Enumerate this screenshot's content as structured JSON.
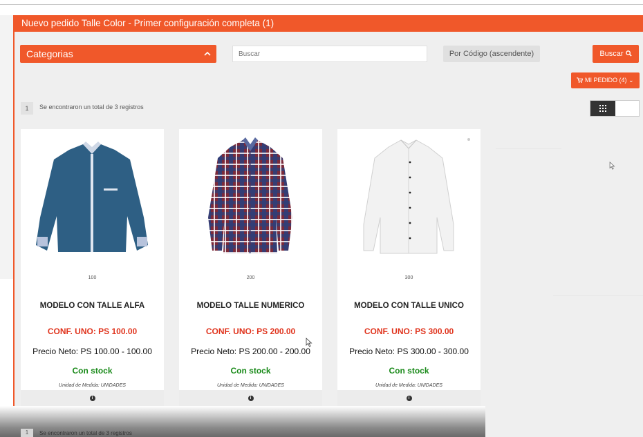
{
  "window": {
    "title": "Nuevo pedido Talle Color - Primer configuración completa (1)"
  },
  "toolbar": {
    "categories_label": "Categorias",
    "search_placeholder": "Buscar",
    "sort_label": "Por Código (ascendente)",
    "search_button": "Buscar",
    "order_button": "MI PEDIDO",
    "order_count": "(4)"
  },
  "results": {
    "page": "1",
    "summary": "Se encontraron un total de 3 registros"
  },
  "products": [
    {
      "code": "100",
      "name": "MODELO CON TALLE ALFA",
      "conf": "CONF. UNO: PS 100.00",
      "neto": "Precio Neto: PS 100.00 - 100.00",
      "stock": "Con stock",
      "unidad": "Unidad de Medida: UNIDADES",
      "shirt_color": "#2e5f84"
    },
    {
      "code": "200",
      "name": "MODELO TALLE NUMERICO",
      "conf": "CONF. UNO: PS 200.00",
      "neto": "Precio Neto: PS 200.00 - 200.00",
      "stock": "Con stock",
      "unidad": "Unidad de Medida: UNIDADES",
      "shirt_color": "#7a2a3a"
    },
    {
      "code": "300",
      "name": "MODELO CON TALLE UNICO",
      "conf": "CONF. UNO: PS 300.00",
      "neto": "Precio Neto: PS 300.00 - 300.00",
      "stock": "Con stock",
      "unidad": "Unidad de Medida: UNIDADES",
      "shirt_color": "#f2f2f2"
    }
  ],
  "bottom": {
    "page": "1",
    "summary": "Se encontraron un total de 3 registros"
  },
  "colors": {
    "accent": "#f0582a",
    "price": "#e0331c",
    "stock": "#1a8a1a"
  }
}
